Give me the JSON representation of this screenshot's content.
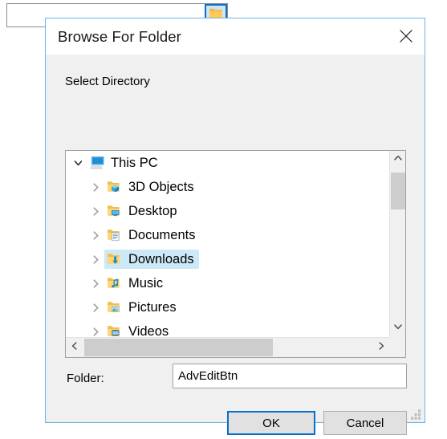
{
  "background_window": {
    "textfield_value": "",
    "textfield_placeholder": "",
    "browse_button_icon": "folder-icon",
    "browse_button_label": ""
  },
  "dialog": {
    "title": "Browse For Folder",
    "close_icon": "close-icon",
    "prompt_label": "Select Directory",
    "tree": {
      "root": {
        "label": "This PC",
        "icon": "this-pc-icon",
        "expanded": true,
        "chevron": "chevron-down-icon"
      },
      "items": [
        {
          "label": "3D Objects",
          "icon": "folder-3d-objects-icon",
          "chevron": "chevron-right-icon",
          "selected": false
        },
        {
          "label": "Desktop",
          "icon": "folder-desktop-icon",
          "chevron": "chevron-right-icon",
          "selected": false
        },
        {
          "label": "Documents",
          "icon": "folder-documents-icon",
          "chevron": "chevron-right-icon",
          "selected": false
        },
        {
          "label": "Downloads",
          "icon": "folder-downloads-icon",
          "chevron": "chevron-right-icon",
          "selected": true
        },
        {
          "label": "Music",
          "icon": "folder-music-icon",
          "chevron": "chevron-right-icon",
          "selected": false
        },
        {
          "label": "Pictures",
          "icon": "folder-pictures-icon",
          "chevron": "chevron-right-icon",
          "selected": false
        },
        {
          "label": "Videos",
          "icon": "folder-videos-icon",
          "chevron": "chevron-right-icon",
          "selected": false
        }
      ],
      "scrollbars": {
        "vertical_up_icon": "chevron-up-icon",
        "vertical_down_icon": "chevron-down-icon",
        "horizontal_left_icon": "chevron-left-icon",
        "horizontal_right_icon": "chevron-right-icon"
      }
    },
    "folder_field": {
      "label": "Folder:",
      "value": "AdvEditBtn",
      "placeholder": ""
    },
    "buttons": {
      "ok": "OK",
      "cancel": "Cancel"
    },
    "resize_grip_icon": "resize-grip-icon"
  },
  "colors": {
    "dialog_border": "#6cb4e8",
    "focus_blue": "#0a70c8",
    "selection_blue": "#cde8f7",
    "body_gray": "#f0f0f0",
    "scrollbar_thumb": "#cdcdcd",
    "folder_yellow": "#ffca57"
  }
}
